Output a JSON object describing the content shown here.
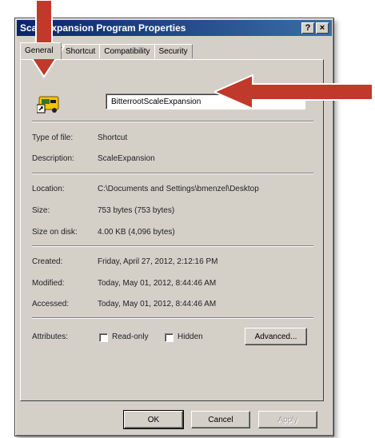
{
  "window": {
    "title": "ScaleExpansion Program Properties",
    "help_button": "?",
    "close_button": "×"
  },
  "tabs": [
    {
      "label": "General"
    },
    {
      "label": "Shortcut"
    },
    {
      "label": "Compatibility"
    },
    {
      "label": "Security"
    }
  ],
  "general": {
    "file_name": "BitterrootScaleExpansion",
    "type_label": "Type of file:",
    "type_value": "Shortcut",
    "description_label": "Description:",
    "description_value": "ScaleExpansion",
    "location_label": "Location:",
    "location_value": "C:\\Documents and Settings\\bmenzel\\Desktop",
    "size_label": "Size:",
    "size_value": "753 bytes (753 bytes)",
    "size_on_disk_label": "Size on disk:",
    "size_on_disk_value": "4.00 KB (4,096 bytes)",
    "created_label": "Created:",
    "created_value": "Friday, April 27, 2012, 2:12:16 PM",
    "modified_label": "Modified:",
    "modified_value": "Today, May 01, 2012, 8:44:46 AM",
    "accessed_label": "Accessed:",
    "accessed_value": "Today, May 01, 2012, 8:44:46 AM",
    "attributes_label": "Attributes:",
    "readonly_label": "Read-only",
    "hidden_label": "Hidden",
    "advanced_button": "Advanced..."
  },
  "footer": {
    "ok": "OK",
    "cancel": "Cancel",
    "apply": "Apply"
  },
  "annotations": {
    "arrow_color": "#c0392b"
  }
}
